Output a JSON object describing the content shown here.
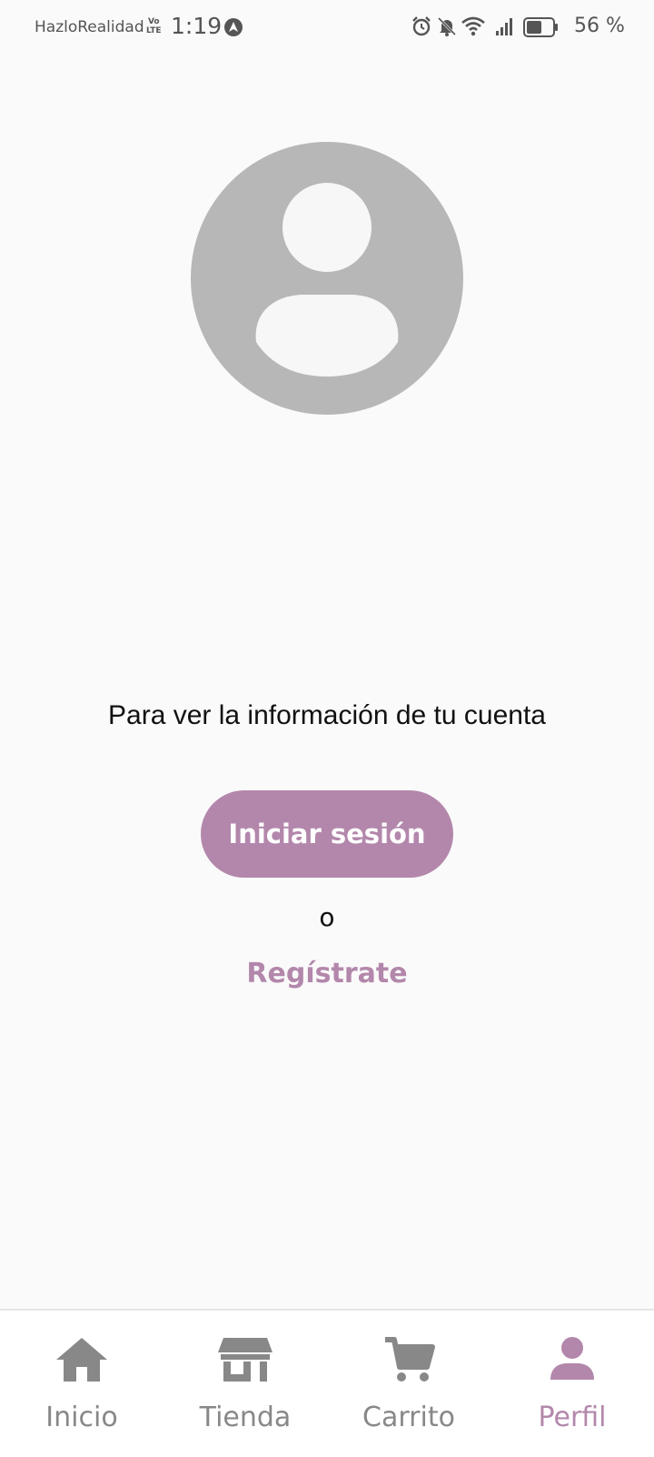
{
  "status_bar": {
    "carrier": "HazloRealidad",
    "volte_top": "Vo",
    "volte_bottom": "LTE",
    "time": "1:19",
    "battery": "56 %"
  },
  "profile": {
    "prompt": "Para ver la información de tu cuenta",
    "login_label": "Iniciar sesión",
    "or_text": "o",
    "register_label": "Regístrate"
  },
  "bottom_nav": {
    "items": [
      {
        "label": "Inicio",
        "icon": "home-icon"
      },
      {
        "label": "Tienda",
        "icon": "store-icon"
      },
      {
        "label": "Carrito",
        "icon": "cart-icon"
      },
      {
        "label": "Perfil",
        "icon": "person-icon"
      }
    ],
    "active_index": 3
  },
  "colors": {
    "accent": "#b387ab",
    "inactive": "#888888",
    "avatar": "#b7b7b7",
    "background": "#fafafa"
  }
}
